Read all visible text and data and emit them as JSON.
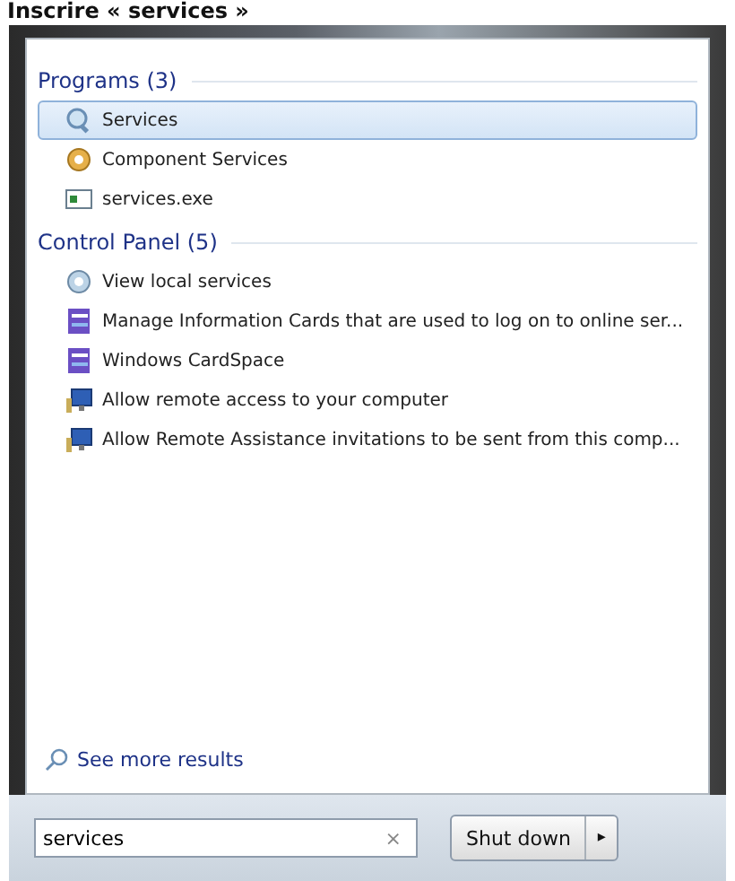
{
  "caption": "Inscrire « services »",
  "sections": [
    {
      "title": "Programs (3)",
      "items": [
        {
          "label": "Services",
          "kind": "console",
          "selected": true
        },
        {
          "label": "Component Services",
          "kind": "component",
          "selected": false
        },
        {
          "label": "services.exe",
          "kind": "executable",
          "selected": false
        }
      ]
    },
    {
      "title": "Control Panel (5)",
      "items": [
        {
          "label": "View local services",
          "kind": "applet",
          "selected": false
        },
        {
          "label": "Manage Information Cards that are used to log on to online ser...",
          "kind": "card",
          "selected": false
        },
        {
          "label": "Windows CardSpace",
          "kind": "card",
          "selected": false
        },
        {
          "label": "Allow remote access to your computer",
          "kind": "remote",
          "selected": false
        },
        {
          "label": "Allow Remote Assistance invitations to be sent from this comp...",
          "kind": "remote",
          "selected": false
        }
      ]
    }
  ],
  "see_more": "See more results",
  "search": {
    "value": "services",
    "clear": "×"
  },
  "shutdown": {
    "label": "Shut down",
    "arrow": "▸"
  }
}
